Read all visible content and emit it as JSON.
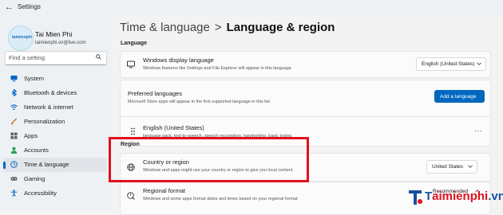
{
  "window": {
    "title": "Settings"
  },
  "profile": {
    "name": "Tai Mien Phi",
    "email": "taimienphi.vn@live.com",
    "avatar_text": "taimienphi"
  },
  "search": {
    "placeholder": "Find a setting"
  },
  "sidebar": {
    "items": [
      {
        "label": "System",
        "icon": "monitor-icon",
        "color": "#0067c0",
        "active": false
      },
      {
        "label": "Bluetooth & devices",
        "icon": "bluetooth-icon",
        "color": "#0067c0",
        "active": false
      },
      {
        "label": "Network & internet",
        "icon": "wifi-icon",
        "color": "#0067c0",
        "active": false
      },
      {
        "label": "Personalization",
        "icon": "brush-icon",
        "color": "#c7742a",
        "active": false
      },
      {
        "label": "Apps",
        "icon": "apps-icon",
        "color": "#5a6170",
        "active": false
      },
      {
        "label": "Accounts",
        "icon": "person-icon",
        "color": "#1f9d55",
        "active": false
      },
      {
        "label": "Time & language",
        "icon": "globe-clock-icon",
        "color": "#0067c0",
        "active": true
      },
      {
        "label": "Gaming",
        "icon": "controller-icon",
        "color": "#5a6170",
        "active": false
      },
      {
        "label": "Accessibility",
        "icon": "accessibility-icon",
        "color": "#0067c0",
        "active": false
      }
    ]
  },
  "breadcrumb": {
    "parent": "Time & language",
    "separator": ">",
    "current": "Language & region"
  },
  "language_section": {
    "heading": "Language",
    "display_language": {
      "title": "Windows display language",
      "desc": "Windows features like Settings and File Explorer will appear in this language",
      "value": "English (United States)"
    },
    "preferred": {
      "title": "Preferred languages",
      "desc": "Microsoft Store apps will appear in the first supported language in this list",
      "button": "Add a language"
    },
    "english": {
      "title": "English (United States)",
      "desc": "language pack, text-to-speech, speech recognition, handwriting, basic typing",
      "more": "..."
    }
  },
  "region_section": {
    "heading": "Region",
    "country": {
      "title": "Country or region",
      "desc": "Windows and apps might use your country or region to give you local content",
      "value": "United States"
    },
    "format": {
      "title": "Regional format",
      "desc": "Windows and some apps format dates and times based on your regional format",
      "value": "Recommended"
    }
  },
  "watermark": {
    "prefix": "T",
    "brand": "aimienphi",
    "suffix": ".vn"
  },
  "colors": {
    "accent": "#0067c0",
    "highlight_box": "#e2101d"
  }
}
